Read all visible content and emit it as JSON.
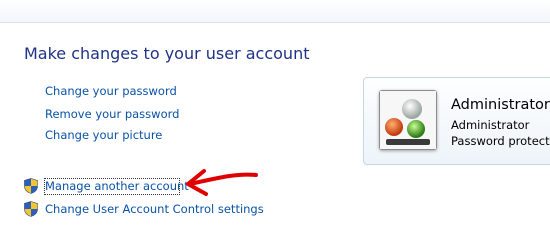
{
  "page_title": "Make changes to your user account",
  "links": {
    "change_password": "Change your password",
    "remove_password": "Remove your password",
    "change_picture": "Change your picture",
    "manage_account": "Manage another account",
    "uac_settings": "Change User Account Control settings"
  },
  "account": {
    "name": "Administrator",
    "type": "Administrator",
    "status": "Password protected"
  },
  "icons": {
    "uac": "uac-shield-icon",
    "avatar": "chess-pieces-avatar",
    "annotation": "red-arrow"
  },
  "colors": {
    "title": "#1e3287",
    "link": "#0a52a6",
    "arrow": "#e00000"
  }
}
